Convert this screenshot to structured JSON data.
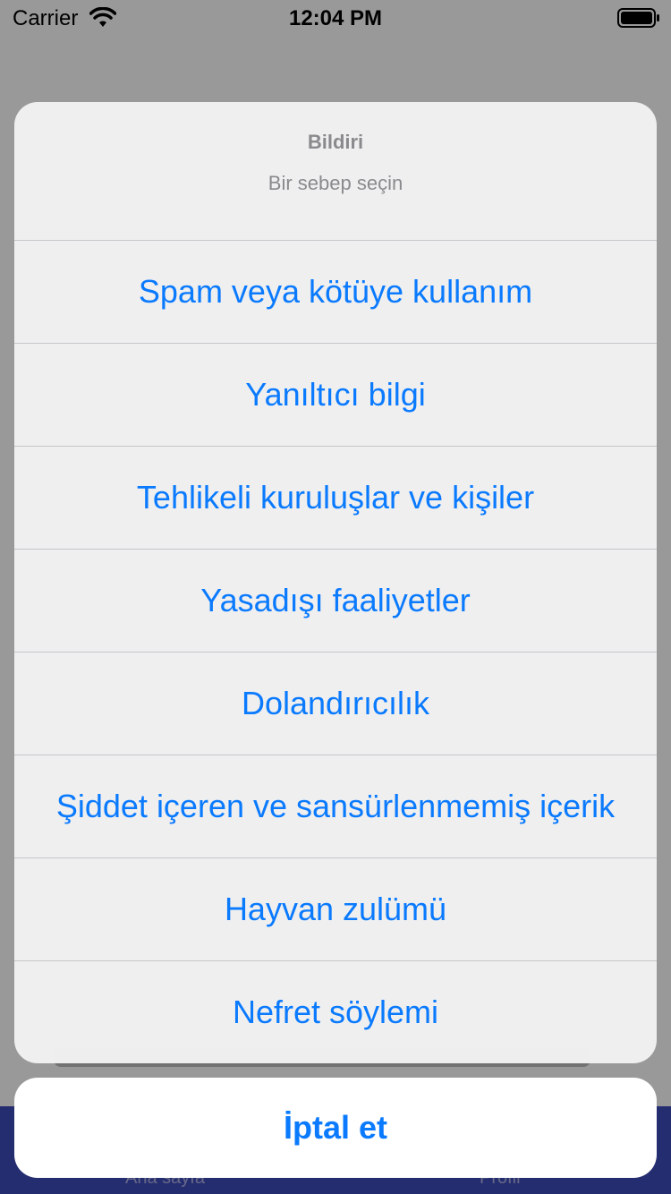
{
  "status_bar": {
    "carrier": "Carrier",
    "time": "12:04 PM",
    "wifi_icon": "wifi-icon",
    "battery_icon": "battery-icon"
  },
  "background": {
    "tab_home": "Ana sayfa",
    "tab_profile": "Profil"
  },
  "sheet": {
    "title": "Bildiri",
    "message": "Bir sebep seçin",
    "options": [
      "Spam veya kötüye kullanım",
      "Yanıltıcı bilgi",
      "Tehlikeli kuruluşlar ve kişiler",
      "Yasadışı faaliyetler",
      "Dolandırıcılık",
      "Şiddet içeren ve sansürlenmemiş içerik",
      "Hayvan zulümü",
      "Nefret söylemi"
    ],
    "cancel": "İptal et"
  },
  "colors": {
    "accent": "#0a7aff",
    "tabbar": "#3f4bbd",
    "sheet_bg": "#f2f2f2",
    "muted_text": "#8a8a8e"
  }
}
